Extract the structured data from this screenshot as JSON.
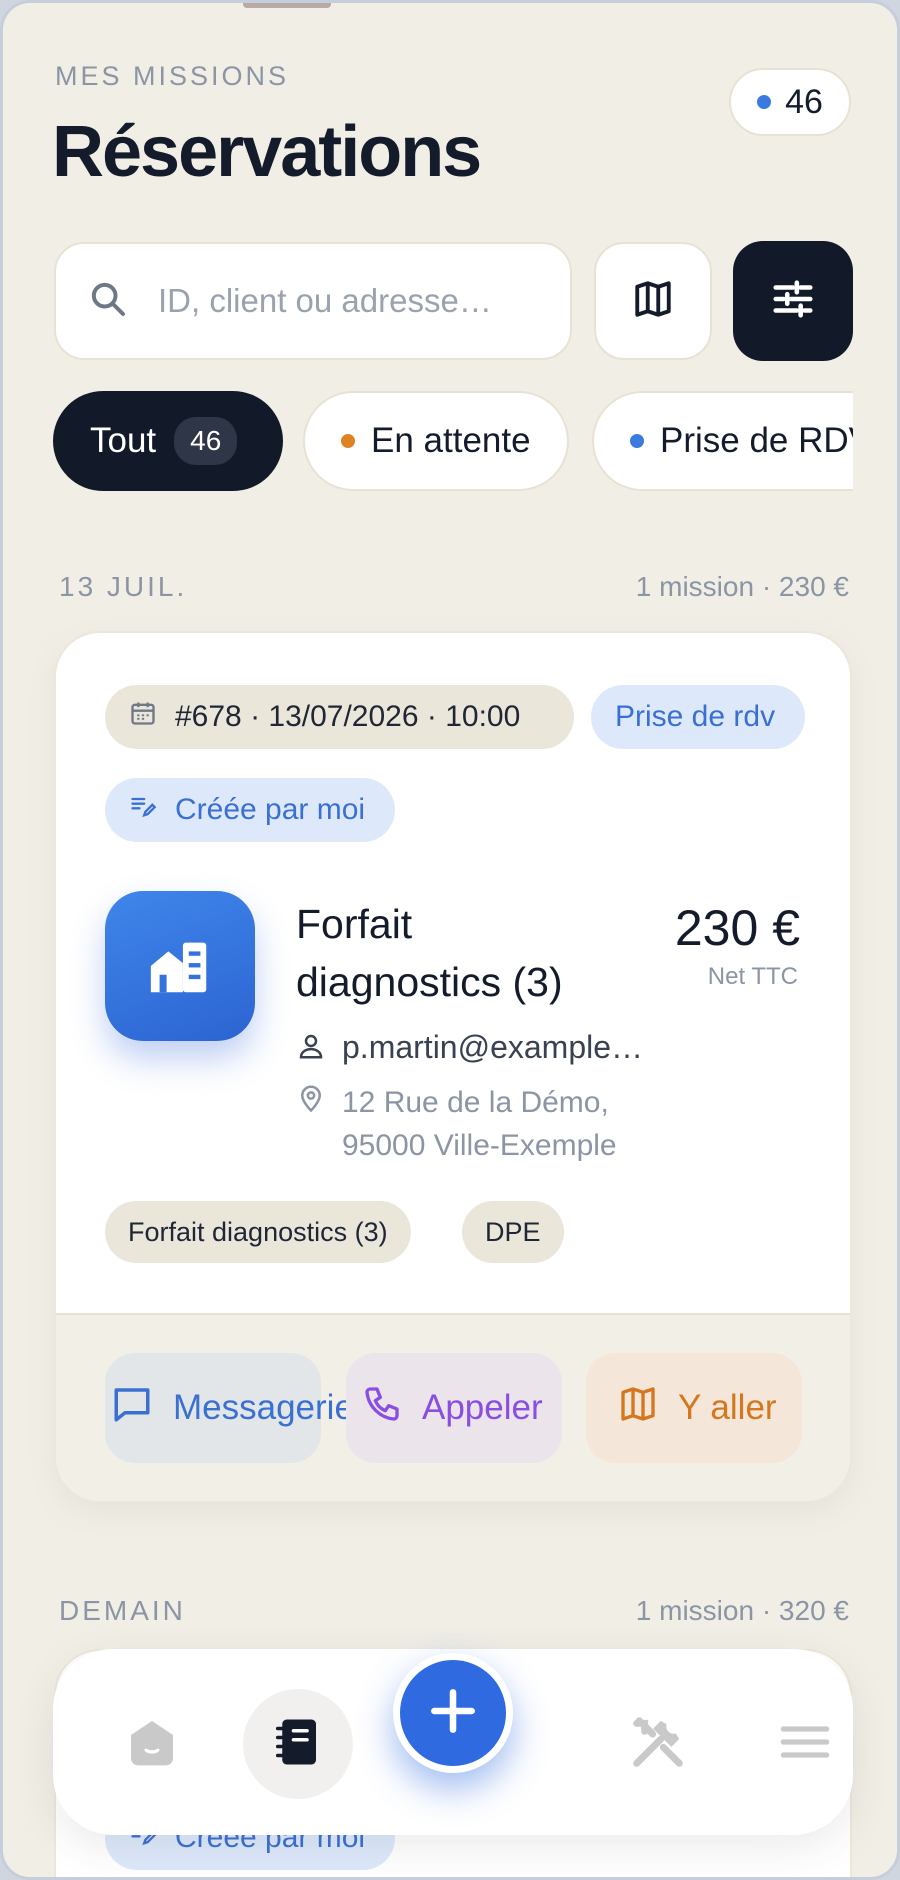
{
  "header": {
    "eyebrow": "MES MISSIONS",
    "title": "Réservations",
    "count": "46"
  },
  "search": {
    "placeholder": "ID, client ou adresse…"
  },
  "filters": [
    {
      "label": "Tout",
      "count": "46",
      "active": true
    },
    {
      "label": "En attente",
      "dot_color": "#df8225"
    },
    {
      "label": "Prise de RDV",
      "dot_color": "#3b7be0"
    }
  ],
  "groups": [
    {
      "date": "13 JUIL.",
      "summary": "1 mission · 230 €"
    },
    {
      "date": "DEMAIN",
      "summary": "1 mission · 320 €"
    }
  ],
  "mission": {
    "ref": "#678 · 13/07/2026 · 10:00",
    "status": "Prise de rdv",
    "origin": "Créée par moi",
    "service": "Forfait diagnostics (3)",
    "price": "230 €",
    "price_note": "Net TTC",
    "client": "p.martin@example…",
    "address_line1": "12 Rue de la Démo,",
    "address_line2": "95000 Ville-Exemple",
    "chips": [
      "Forfait diagnostics (3)",
      "DPE"
    ],
    "actions": {
      "message": "Messagerie",
      "call": "Appeler",
      "go": "Y aller"
    }
  },
  "mission2": {
    "origin": "Créée par moi"
  },
  "colors": {
    "accent": "#2f6ae0",
    "dark": "#121a2a",
    "background": "#f1eee6"
  },
  "tabbar": {
    "icons": [
      "home-icon",
      "bookings-icon",
      "add-icon",
      "tools-icon",
      "menu-icon"
    ]
  }
}
